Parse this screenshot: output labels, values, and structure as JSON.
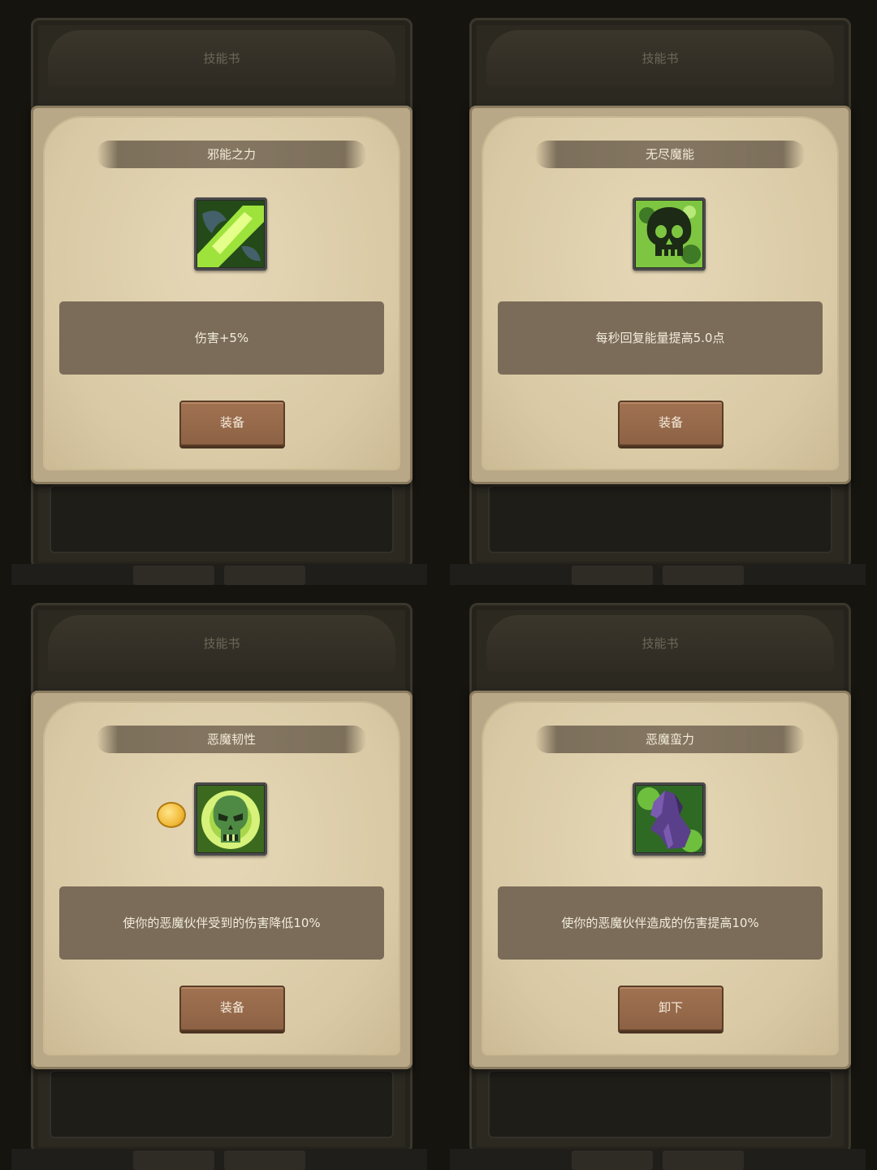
{
  "background": {
    "book_title": "技能书"
  },
  "cards": [
    {
      "title": "邪能之力",
      "icon": "fel-claw-icon",
      "description": "伤害+5%",
      "button": "装备",
      "badge": false
    },
    {
      "title": "无尽魔能",
      "icon": "skull-icon",
      "description": "每秒回复能量提高5.0点",
      "button": "装备",
      "badge": false
    },
    {
      "title": "恶魔韧性",
      "icon": "demon-skull-icon",
      "description": "使你的恶魔伙伴受到的伤害降低10%",
      "button": "装备",
      "badge": true
    },
    {
      "title": "恶魔蛮力",
      "icon": "demon-hand-icon",
      "description": "使你的恶魔伙伴造成的伤害提高10%",
      "button": "卸下",
      "badge": false
    }
  ],
  "colors": {
    "card_bg": "#d9c9a5",
    "ribbon": "#847661",
    "desc_bar": "#7b6c59",
    "button": "#8d6244",
    "icon_green": "#7ec641"
  }
}
